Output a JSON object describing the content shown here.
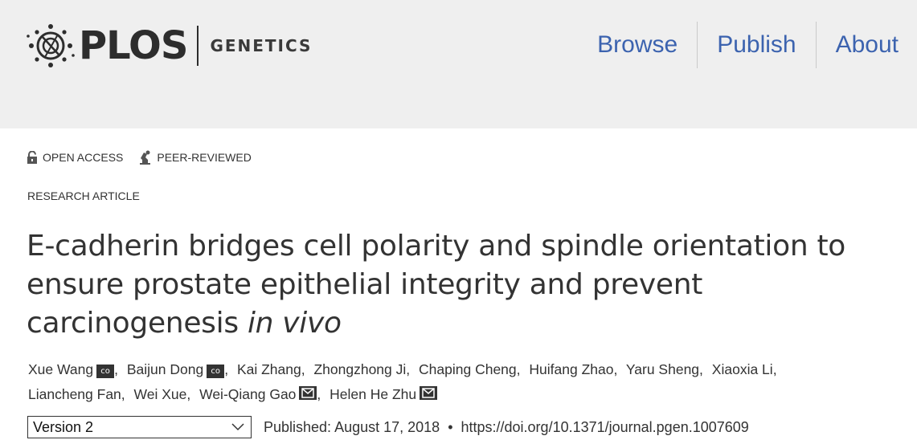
{
  "header": {
    "logo_text": "PLOS",
    "journal": "GENETICS",
    "nav": [
      {
        "label": "Browse"
      },
      {
        "label": "Publish"
      },
      {
        "label": "About"
      }
    ]
  },
  "badges": {
    "open_access": "OPEN ACCESS",
    "peer_reviewed": "PEER-REVIEWED"
  },
  "article_type": "RESEARCH ARTICLE",
  "title": {
    "main": "E-cadherin bridges cell polarity and spindle orientation to ensure prostate epithelial integrity and prevent carcinogenesis ",
    "italic": "in vivo"
  },
  "authors": [
    {
      "name": "Xue Wang",
      "badge": "co"
    },
    {
      "name": "Baijun Dong",
      "badge": "co"
    },
    {
      "name": "Kai Zhang"
    },
    {
      "name": "Zhongzhong Ji"
    },
    {
      "name": "Chaping Cheng"
    },
    {
      "name": "Huifang Zhao"
    },
    {
      "name": "Yaru Sheng"
    },
    {
      "name": "Xiaoxia Li"
    },
    {
      "name": "Liancheng Fan"
    },
    {
      "name": "Wei Xue"
    },
    {
      "name": "Wei-Qiang Gao",
      "badge": "mail"
    },
    {
      "name": "Helen He Zhu",
      "badge": "mail"
    }
  ],
  "co_badge_text": "co",
  "version": {
    "selected": "Version 2"
  },
  "published": "Published: August 17, 2018",
  "bullet": "•",
  "doi": "https://doi.org/10.1371/journal.pgen.1007609",
  "colors": {
    "header_bg": "#efefef",
    "nav_link": "#3c63af",
    "text": "#333333"
  },
  "icons": {
    "logo": "plos-logo-icon",
    "open_access": "unlocked-padlock-icon",
    "peer_reviewed": "peer-reviewed-icon",
    "mail": "envelope-icon",
    "select": "chevron-down-icon"
  }
}
